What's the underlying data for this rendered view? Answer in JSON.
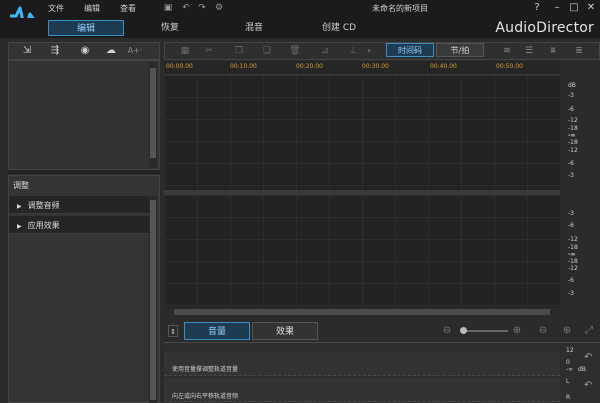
{
  "menu": {
    "file": "文件",
    "edit": "编辑",
    "view": "查看"
  },
  "window": {
    "title": "未命名的新项目",
    "help": "?",
    "minimize": "–",
    "maximize": "□",
    "close": "✕"
  },
  "modes": [
    {
      "label": "编辑"
    },
    {
      "label": "恢复"
    },
    {
      "label": "混音"
    },
    {
      "label": "创建 CD"
    }
  ],
  "brand": "AudioDirector",
  "left_toolbar": {
    "text_size": "A+·"
  },
  "adjust": {
    "title": "调整",
    "items": [
      {
        "label": "调整音频"
      },
      {
        "label": "应用效果"
      }
    ]
  },
  "editor_toolbar": {
    "time_code": "时间码",
    "beat": "节/拍"
  },
  "ruler": {
    "ticks": [
      "00:00.00",
      "00:10.00",
      "00:20.00",
      "00:30.00",
      "00:40.00",
      "00:50.00"
    ]
  },
  "db_scale": {
    "track1": [
      "dB",
      "-3",
      "-6",
      "-12",
      "-18",
      "-∞",
      "-18",
      "-12",
      "-6",
      "-3"
    ],
    "track2": [
      "-3",
      "-6",
      "-12",
      "-18",
      "-∞",
      "-18",
      "-12",
      "-6",
      "-3"
    ]
  },
  "bottom_tabs": {
    "volume": "音量",
    "effects": "效果"
  },
  "envelope": {
    "volume_hint": "使用音量撑调整轨道音量",
    "pan_hint": "向左或向右平移轨道音频",
    "side": {
      "top": "12",
      "zero": "0",
      "db": "dB",
      "minus": "-∞",
      "left": "L",
      "right": "R"
    }
  }
}
